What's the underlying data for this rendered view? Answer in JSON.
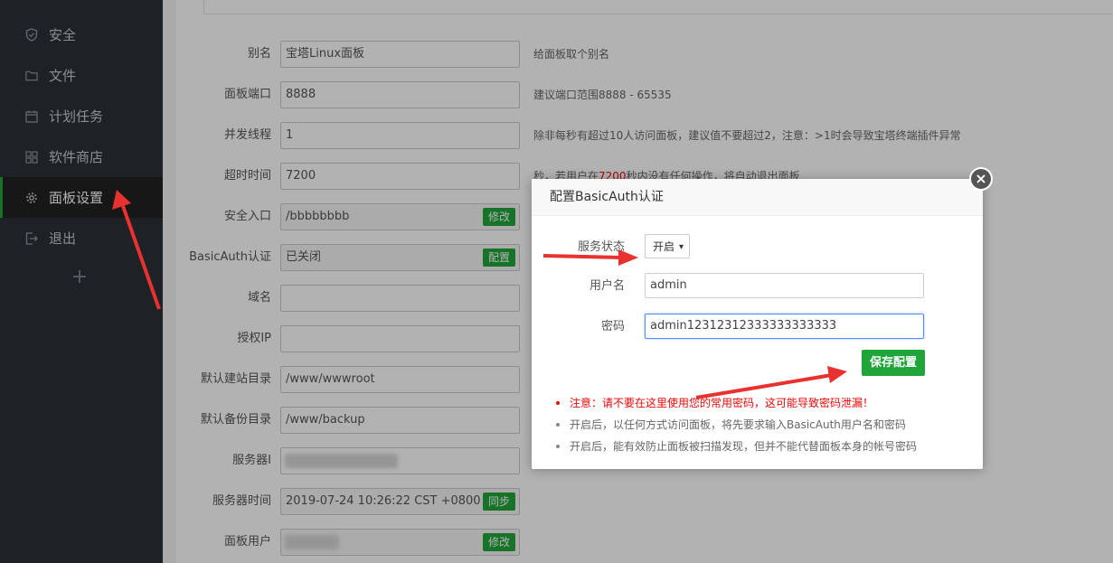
{
  "sidebar": {
    "items": [
      {
        "label": "安全",
        "icon": "shield-icon"
      },
      {
        "label": "文件",
        "icon": "folder-icon"
      },
      {
        "label": "计划任务",
        "icon": "calendar-icon"
      },
      {
        "label": "软件商店",
        "icon": "grid-icon"
      },
      {
        "label": "面板设置",
        "icon": "gear-icon",
        "active": true
      },
      {
        "label": "退出",
        "icon": "logout-icon"
      }
    ],
    "add_label": "+"
  },
  "settings": {
    "alias": {
      "label": "别名",
      "value": "宝塔Linux面板",
      "hint": "给面板取个别名"
    },
    "port": {
      "label": "面板端口",
      "value": "8888",
      "hint": "建议端口范围8888 - 65535"
    },
    "threads": {
      "label": "并发线程",
      "value": "1",
      "hint": "除非每秒有超过10人访问面板，建议值不要超过2，注意：>1时会导致宝塔终端插件异常"
    },
    "timeout": {
      "label": "超时时间",
      "value": "7200",
      "hint_pre": "秒，若用户在",
      "hint_red": "7200",
      "hint_post": "秒内没有任何操作，将自动退出面板"
    },
    "entry": {
      "label": "安全入口",
      "value": "/bbbbbbbb",
      "button": "修改"
    },
    "basicauth": {
      "label": "BasicAuth认证",
      "value": "已关闭",
      "button": "配置"
    },
    "domain": {
      "label": "域名",
      "value": ""
    },
    "auth_ip": {
      "label": "授权IP",
      "value": ""
    },
    "site_dir": {
      "label": "默认建站目录",
      "value": "/www/wwwroot"
    },
    "backup_dir": {
      "label": "默认备份目录",
      "value": "/www/backup"
    },
    "server_ip": {
      "label": "服务器I"
    },
    "server_time": {
      "label": "服务器时间",
      "value": "2019-07-24 10:26:22 CST +0800",
      "button": "同步"
    },
    "panel_user": {
      "label": "面板用户",
      "button": "修改"
    }
  },
  "modal": {
    "title": "配置BasicAuth认证",
    "close": "×",
    "status": {
      "label": "服务状态",
      "value": "开启",
      "caret": "▾"
    },
    "username": {
      "label": "用户名",
      "value": "admin"
    },
    "password": {
      "label": "密码",
      "value": "admin12312312333333333333"
    },
    "save_label": "保存配置",
    "notes": [
      {
        "text": "注意：请不要在这里使用您的常用密码，这可能导致密码泄漏！",
        "warn": true
      },
      {
        "text": "开启后，以任何方式访问面板，将先要求输入BasicAuth用户名和密码",
        "warn": false
      },
      {
        "text": "开启后，能有效防止面板被扫描发现，但并不能代替面板本身的帐号密码",
        "warn": false
      }
    ]
  },
  "colors": {
    "accent": "#20a53a",
    "sidebar": "#2b3138",
    "warning": "#ef0808",
    "annotation_arrow": "#e8322f"
  }
}
